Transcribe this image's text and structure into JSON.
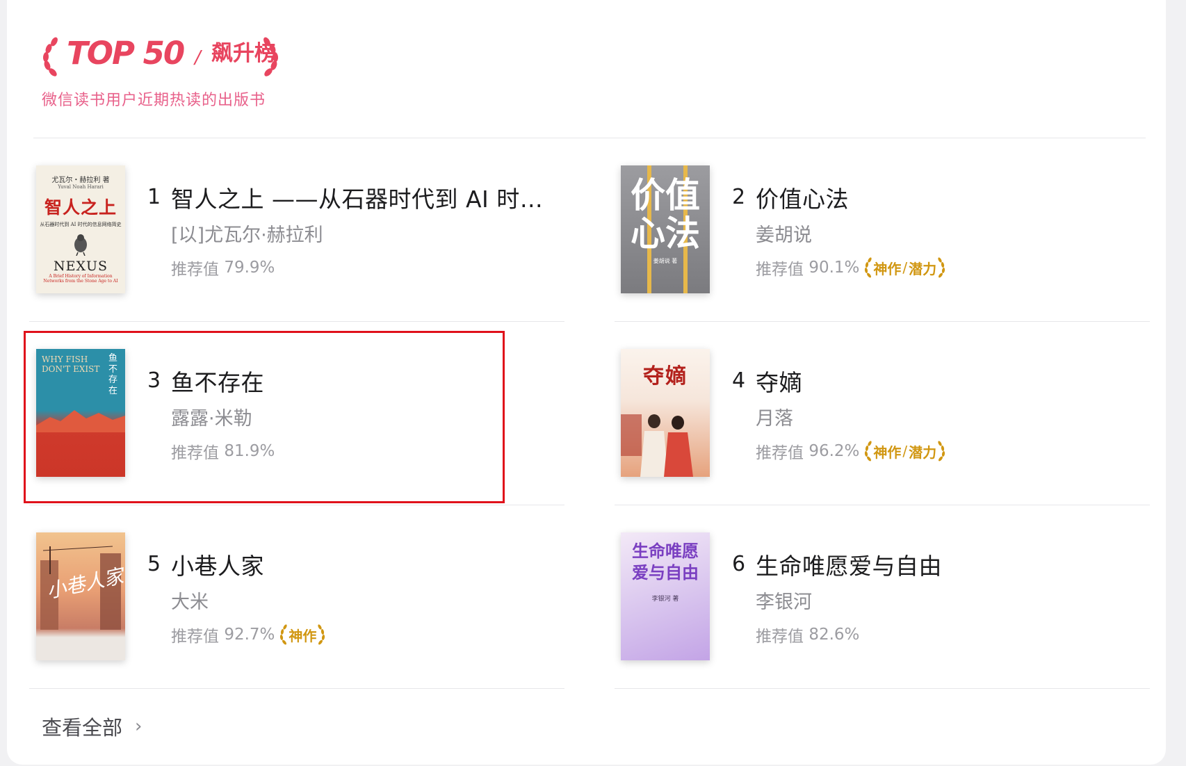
{
  "header": {
    "logo_text": "TOP 50",
    "logo_slash": "/",
    "rank_title": "飙升榜",
    "subtitle": "微信读书用户近期热读的出版书"
  },
  "books": [
    {
      "rank": "1",
      "title": "智人之上 ——从石器时代到 AI 时代...",
      "author": "[以]尤瓦尔·赫拉利",
      "rec_label": "推荐值",
      "rec_value": "79.9%",
      "badges": [],
      "cover": {
        "top": "尤瓦尔・赫拉利 著",
        "sub": "Yuval Noah Harari",
        "main": "智人之上",
        "line": "从石器时代到 AI 时代的信息网络简史",
        "en": "NEXUS",
        "en_sub": "A Brief History of Information Networks from the Stone Age to AI"
      }
    },
    {
      "rank": "2",
      "title": "价值心法",
      "author": "姜胡说",
      "rec_label": "推荐值",
      "rec_value": "90.1%",
      "badges": [
        "神作",
        "潜力"
      ],
      "cover": {
        "main1": "价值",
        "main2": "心法",
        "author": "姜胡说 著"
      }
    },
    {
      "rank": "3",
      "title": "鱼不存在",
      "author": "露露·米勒",
      "rec_label": "推荐值",
      "rec_value": "81.9%",
      "badges": [],
      "cover": {
        "en1": "WHY FISH",
        "en2": "DON'T EXIST",
        "vertical": "鱼不存在"
      }
    },
    {
      "rank": "4",
      "title": "夺嫡",
      "author": "月落",
      "rec_label": "推荐值",
      "rec_value": "96.2%",
      "badges": [
        "神作",
        "潜力"
      ],
      "cover": {
        "main": "夺嫡"
      }
    },
    {
      "rank": "5",
      "title": "小巷人家",
      "author": "大米",
      "rec_label": "推荐值",
      "rec_value": "92.7%",
      "badges": [
        "神作"
      ],
      "cover": {
        "main": "小巷人家"
      }
    },
    {
      "rank": "6",
      "title": "生命唯愿爱与自由",
      "author": "李银河",
      "rec_label": "推荐值",
      "rec_value": "82.6%",
      "badges": [],
      "cover": {
        "main1": "生命唯愿",
        "main2": "爱与自由",
        "author": "李银河 著"
      }
    }
  ],
  "footer": {
    "view_all": "查看全部",
    "chevron": "›"
  },
  "colors": {
    "accent": "#e8455f",
    "subtitle": "#e8608a",
    "badge": "#d19712",
    "highlight": "#e0111b"
  }
}
